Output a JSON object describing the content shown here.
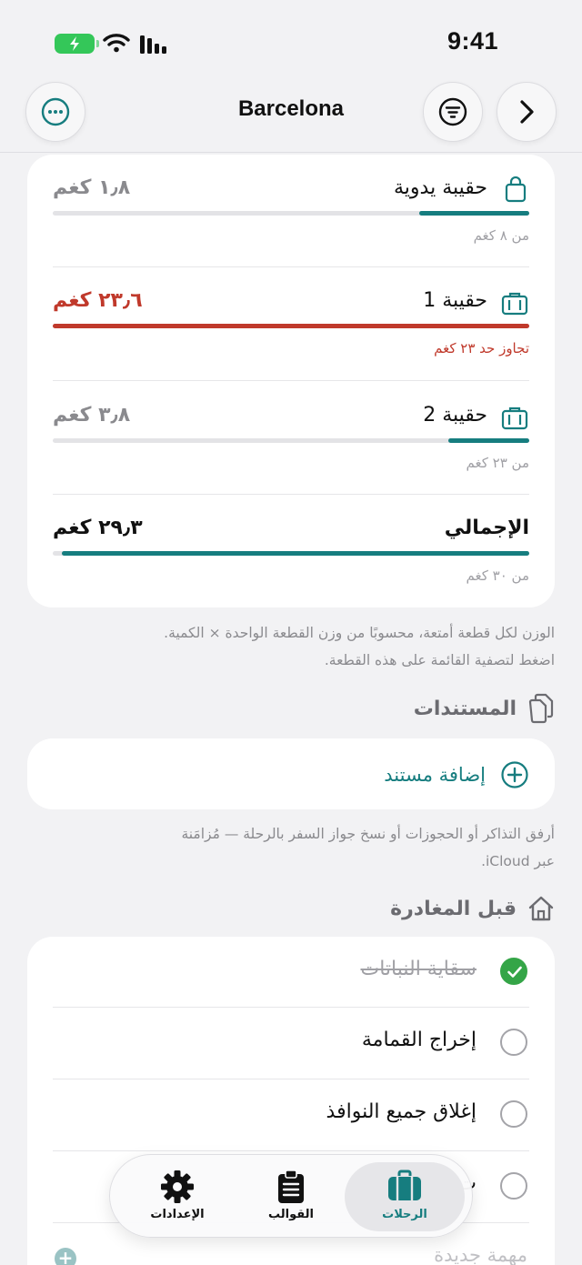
{
  "colors": {
    "accent": "#167d7f",
    "danger": "#c0392b",
    "success": "#34a547"
  },
  "status_bar": {
    "time": "9:41"
  },
  "nav": {
    "title": "Barcelona"
  },
  "luggage": {
    "bags": [
      {
        "name": "حقيبة يدوية",
        "weight": "١٫٨ كغم",
        "sub": "من ٨ كغم",
        "fill_fraction": 0.23,
        "over": false,
        "icon": "bag-icon"
      },
      {
        "name": "حقيبة 1",
        "weight": "٢٣٫٦ كغم",
        "sub": "تجاوز حد ٢٣ كغم",
        "fill_fraction": 1.0,
        "over": true,
        "icon": "suitcase-icon"
      },
      {
        "name": "حقيبة 2",
        "weight": "٣٫٨ كغم",
        "sub": "من ٢٣ كغم",
        "fill_fraction": 0.17,
        "over": false,
        "icon": "suitcase-icon"
      }
    ],
    "total": {
      "name": "الإجمالي",
      "weight": "٢٩٫٣ كغم",
      "sub": "من ٣٠ كغم",
      "fill_fraction": 0.98
    }
  },
  "weight_note": {
    "line1": "الوزن لكل قطعة أمتعة، محسوبًا من وزن القطعة الواحدة × الكمية.",
    "line2": "اضغط لتصفية القائمة على هذه القطعة."
  },
  "documents": {
    "header": "المستندات",
    "add_label": "إضافة مستند",
    "note_line1": "أرفق التذاكر أو الحجوزات أو نسخ جواز السفر بالرحلة — مُزامَنة",
    "note_line2": "عبر iCloud."
  },
  "before_departure": {
    "header": "قبل المغادرة",
    "tasks": [
      {
        "label": "سقاية النباتات",
        "done": true
      },
      {
        "label": "إخراج القمامة",
        "done": false
      },
      {
        "label": "إغلاق جميع النوافذ",
        "done": false
      },
      {
        "label": "ت",
        "done": false
      }
    ],
    "new_task_placeholder": "مهمة جديدة"
  },
  "tab_bar": {
    "tabs": [
      {
        "label": "الرحلات",
        "icon": "suitcase-icon",
        "active": true
      },
      {
        "label": "القوالب",
        "icon": "clipboard-icon",
        "active": false
      },
      {
        "label": "الإعدادات",
        "icon": "gear-icon",
        "active": false
      }
    ]
  }
}
